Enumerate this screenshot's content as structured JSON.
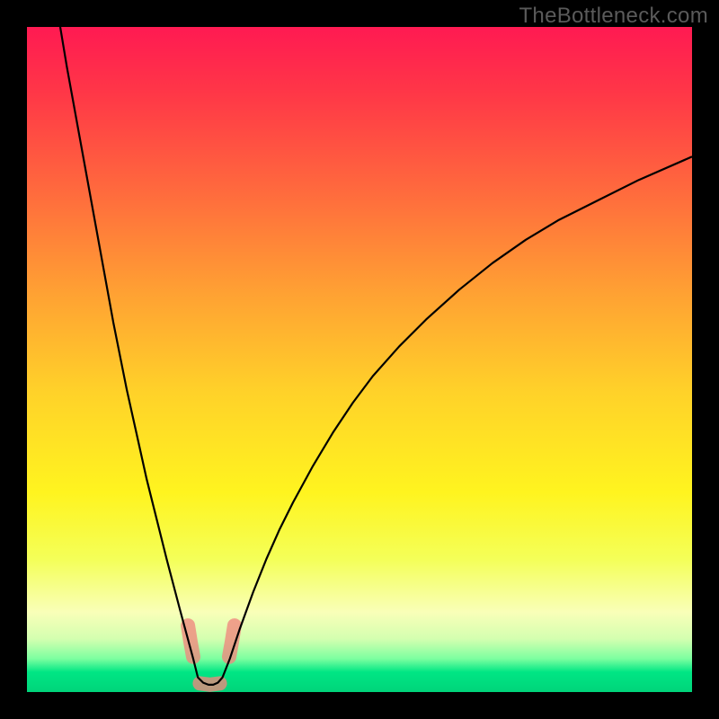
{
  "watermark": "TheBottleneck.com",
  "chart_data": {
    "type": "line",
    "title": "",
    "xlabel": "",
    "ylabel": "",
    "xlim": [
      0,
      100
    ],
    "ylim": [
      0,
      100
    ],
    "background": {
      "gradient_stops": [
        {
          "offset": 0.0,
          "color": "#ff1a52"
        },
        {
          "offset": 0.1,
          "color": "#ff3747"
        },
        {
          "offset": 0.25,
          "color": "#ff6b3d"
        },
        {
          "offset": 0.4,
          "color": "#ffa133"
        },
        {
          "offset": 0.55,
          "color": "#ffd229"
        },
        {
          "offset": 0.7,
          "color": "#fff41f"
        },
        {
          "offset": 0.8,
          "color": "#f4ff58"
        },
        {
          "offset": 0.88,
          "color": "#f9ffb8"
        },
        {
          "offset": 0.92,
          "color": "#d4ffb0"
        },
        {
          "offset": 0.95,
          "color": "#7cffa0"
        },
        {
          "offset": 0.97,
          "color": "#00e684"
        },
        {
          "offset": 1.0,
          "color": "#00d47a"
        }
      ]
    },
    "series": [
      {
        "name": "left-branch",
        "stroke": "#000000",
        "stroke_width": 2.2,
        "x": [
          5,
          6,
          7,
          8,
          9,
          10,
          11,
          12,
          13,
          14,
          15,
          16,
          17,
          18,
          19,
          20,
          21,
          22,
          23,
          24,
          25,
          25.7
        ],
        "values": [
          100,
          94,
          88.5,
          83,
          77.5,
          72,
          66.5,
          61,
          55.5,
          50.5,
          45.5,
          41,
          36.5,
          32,
          28,
          24,
          20,
          16.2,
          12.4,
          8.7,
          5,
          2.2
        ]
      },
      {
        "name": "valley-floor",
        "stroke": "#000000",
        "stroke_width": 2.2,
        "x": [
          25.7,
          26.5,
          27.3,
          28.0,
          28.7,
          29.4
        ],
        "values": [
          2.2,
          1.4,
          1.1,
          1.1,
          1.4,
          2.2
        ]
      },
      {
        "name": "right-branch",
        "stroke": "#000000",
        "stroke_width": 2.2,
        "x": [
          29.4,
          30.5,
          32,
          34,
          36,
          38,
          40,
          43,
          46,
          49,
          52,
          56,
          60,
          65,
          70,
          75,
          80,
          86,
          92,
          100
        ],
        "values": [
          2.2,
          5.0,
          9.5,
          15.0,
          20.0,
          24.5,
          28.5,
          34.0,
          39.0,
          43.5,
          47.5,
          52.0,
          56.0,
          60.5,
          64.5,
          68.0,
          71.0,
          74.0,
          77.0,
          80.5
        ]
      }
    ],
    "markers": [
      {
        "name": "lobe-left",
        "color": "#f0877d",
        "opacity": 0.78,
        "points": [
          {
            "x": 24.2,
            "y": 10.0
          },
          {
            "x": 24.6,
            "y": 7.5
          },
          {
            "x": 25.0,
            "y": 5.3
          }
        ],
        "stroke_width": 16
      },
      {
        "name": "lobe-right",
        "color": "#f0877d",
        "opacity": 0.78,
        "points": [
          {
            "x": 30.4,
            "y": 5.3
          },
          {
            "x": 30.8,
            "y": 7.5
          },
          {
            "x": 31.2,
            "y": 10.0
          }
        ],
        "stroke_width": 16
      },
      {
        "name": "lobe-bottom",
        "color": "#f0877d",
        "opacity": 0.78,
        "points": [
          {
            "x": 26.0,
            "y": 1.3
          },
          {
            "x": 27.5,
            "y": 1.1
          },
          {
            "x": 29.0,
            "y": 1.3
          }
        ],
        "stroke_width": 16
      }
    ]
  }
}
